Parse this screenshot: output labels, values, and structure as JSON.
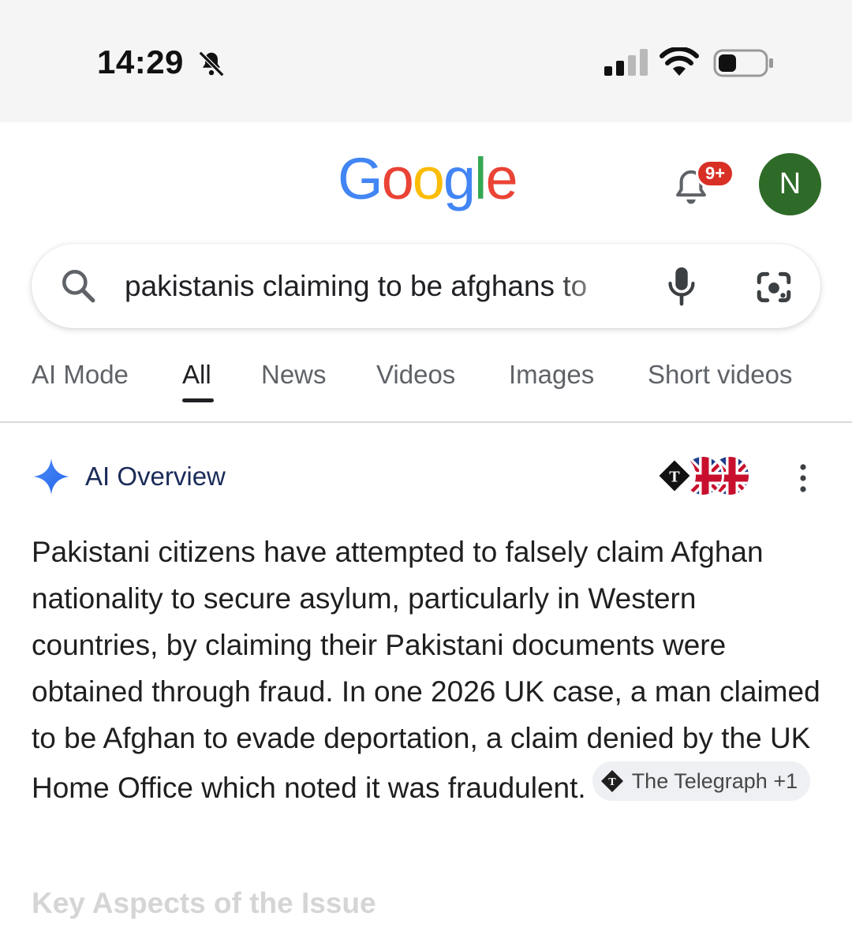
{
  "status_bar": {
    "time": "14:29",
    "icons": [
      "bell-slash-icon",
      "signal-icon",
      "wifi-icon",
      "battery-icon"
    ]
  },
  "header": {
    "logo_letters": [
      {
        "char": "G",
        "color": "#4285F4"
      },
      {
        "char": "o",
        "color": "#EA4335"
      },
      {
        "char": "o",
        "color": "#FBBC05"
      },
      {
        "char": "g",
        "color": "#4285F4"
      },
      {
        "char": "l",
        "color": "#34A853"
      },
      {
        "char": "e",
        "color": "#EA4335"
      }
    ],
    "notification_badge": "9+",
    "avatar_letter": "N",
    "avatar_color": "#2e6b28"
  },
  "search": {
    "query": "pakistanis claiming to be afghans to"
  },
  "tabs": [
    {
      "label": "AI Mode",
      "active": false
    },
    {
      "label": "All",
      "active": true
    },
    {
      "label": "News",
      "active": false
    },
    {
      "label": "Videos",
      "active": false
    },
    {
      "label": "Images",
      "active": false
    },
    {
      "label": "Short videos",
      "active": false
    }
  ],
  "ai_overview": {
    "title": "AI Overview",
    "body": "Pakistani citizens have attempted to falsely claim Afghan nationality to secure asylum, particularly in Western countries, by claiming their Pakistani documents were obtained through fraud. In one 2026 UK case, a man claimed to be Afghan to evade deportation, a claim denied by the UK Home Office which noted it was fraudulent.",
    "citation": "The Telegraph +1",
    "next_heading": "Key Aspects of the Issue"
  },
  "colors": {
    "accent_blue": "#4285F4",
    "ai_title": "#1a2b59",
    "badge_red": "#d93025"
  }
}
